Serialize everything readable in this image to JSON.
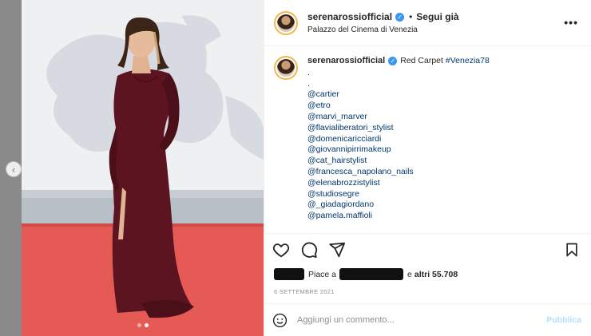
{
  "header": {
    "username": "serenarossiofficial",
    "separator": "•",
    "follow_label": "Segui già",
    "location": "Palazzo del Cinema di Venezia",
    "more_label": "•••"
  },
  "caption": {
    "username": "serenarossiofficial",
    "text": "Red Carpet",
    "hashtag": "#Venezia78",
    "lines": [
      ".",
      ".",
      "@cartier",
      "@etro",
      "@marvi_marver",
      "@flavialiberatori_stylist",
      "@domenicaricciardi",
      "@giovannipirrimakeup",
      "@cat_hairstylist",
      "@francesca_napolano_nails",
      "@elenabrozzistylist",
      "@studiosegre",
      "@_giadagiordano",
      "@pamela.maffioli"
    ]
  },
  "likes": {
    "prefix": "Piace a",
    "connector": "e",
    "others": "altri 55.708"
  },
  "date": "6 SETTEMBRE 2021",
  "comment": {
    "placeholder": "Aggiungi un commento...",
    "publish_label": "Pubblica"
  },
  "icons": {
    "like": "heart-icon",
    "comment": "comment-icon",
    "share": "send-icon",
    "save": "bookmark-icon",
    "emoji": "smiley-icon",
    "prev": "chevron-left-icon",
    "verified": "verified-badge-icon"
  },
  "carousel": {
    "slides": 2,
    "active": 2
  },
  "colors": {
    "link": "#00376b",
    "verified": "#3897f0",
    "publish_disabled": "#b2dffc",
    "muted": "#8e8e8e"
  }
}
